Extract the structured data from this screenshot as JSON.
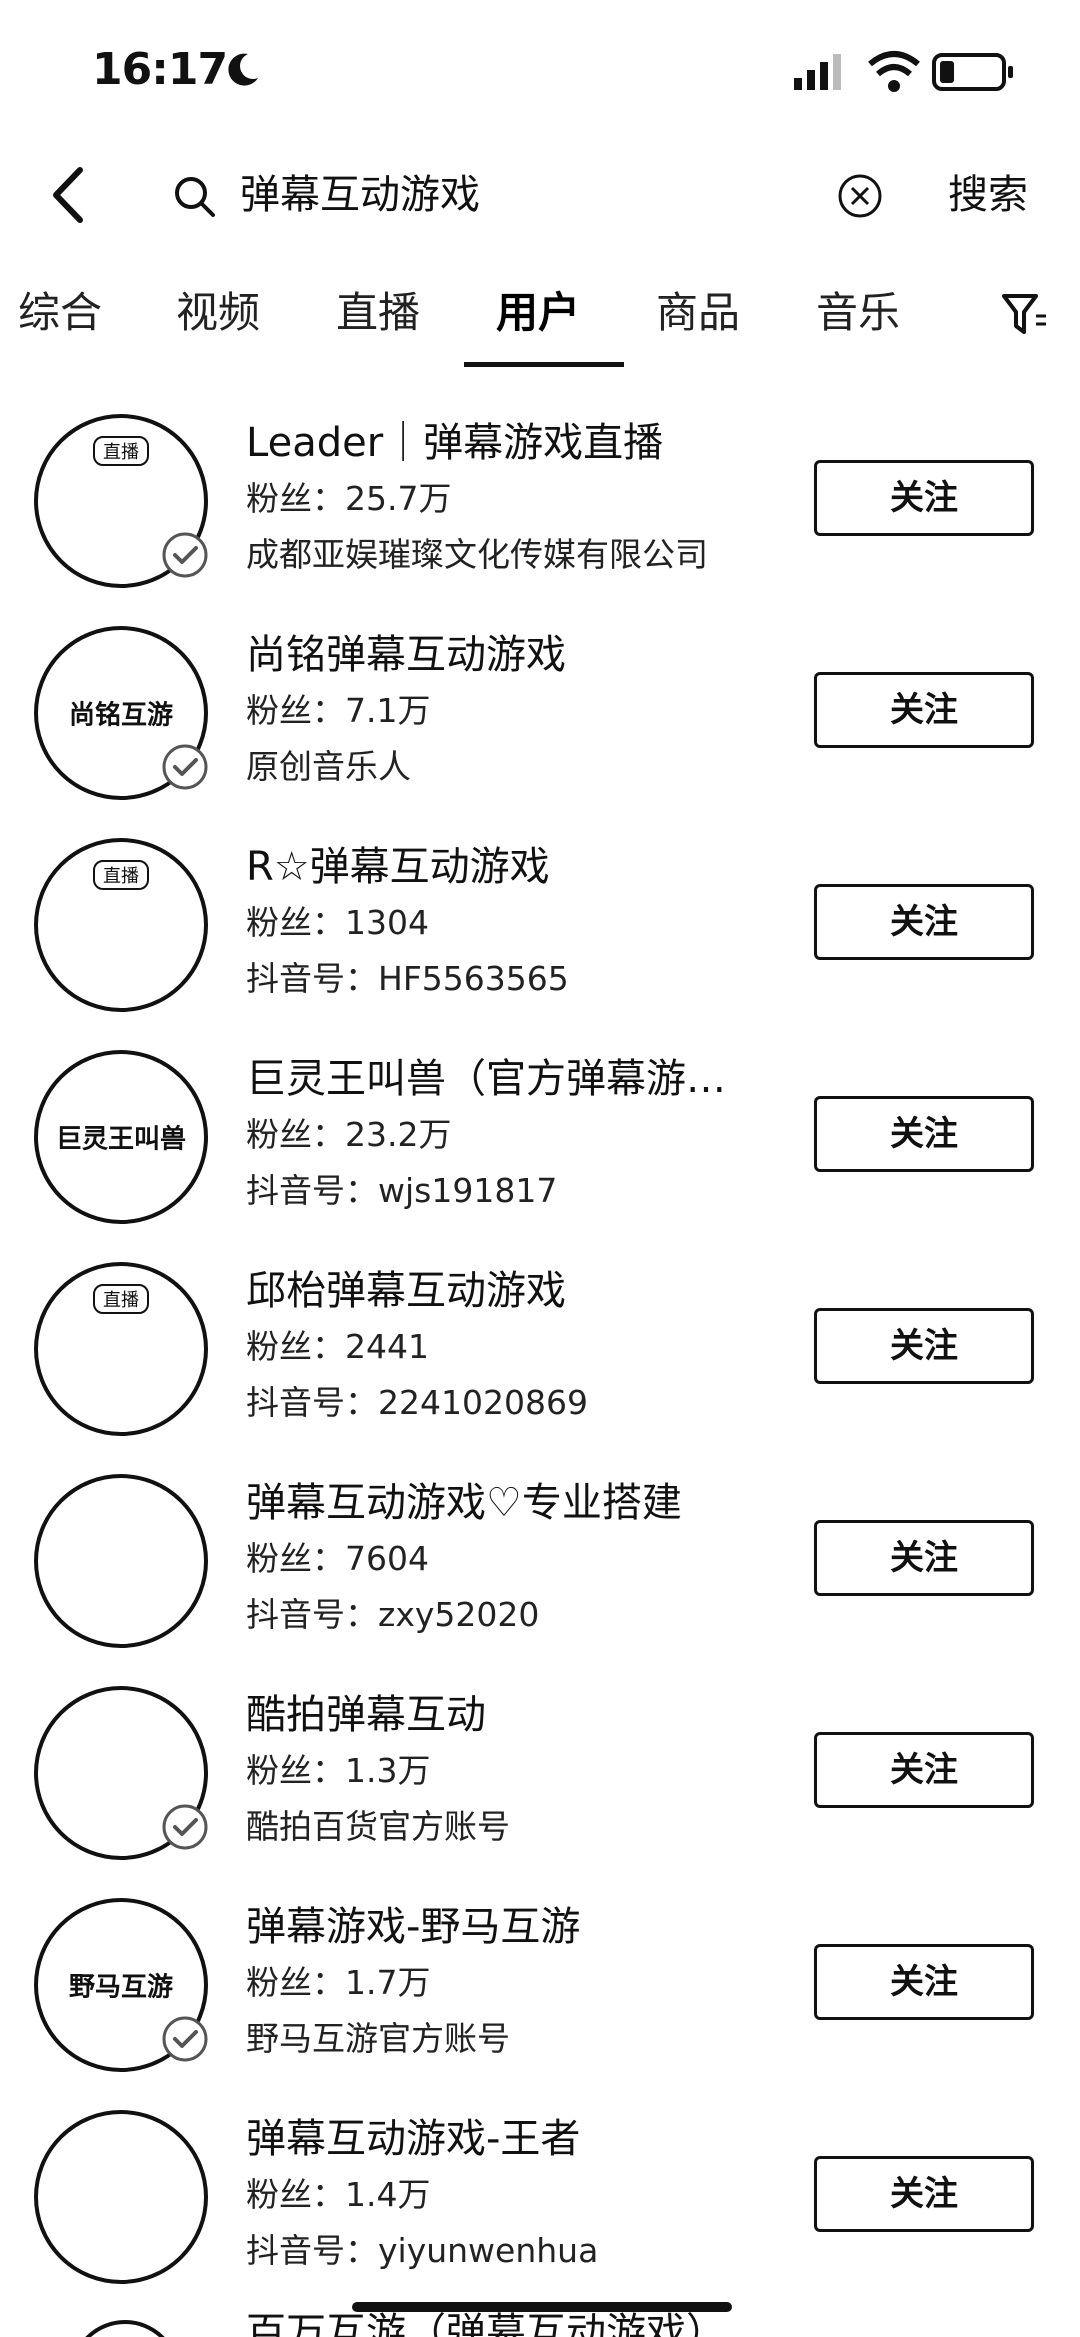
{
  "status_bar": {
    "time": "16:17"
  },
  "search": {
    "query": "弹幕互动游戏",
    "search_label": "搜索"
  },
  "tabs": [
    {
      "label": "综合"
    },
    {
      "label": "视频"
    },
    {
      "label": "直播"
    },
    {
      "label": "用户"
    },
    {
      "label": "商品"
    },
    {
      "label": "音乐"
    }
  ],
  "active_tab": "用户",
  "users": [
    {
      "name": "Leader｜弹幕游戏直播",
      "fans": "粉丝：25.7万",
      "sub": "成都亚娱璀璨文化传媒有限公司",
      "follow": "关注",
      "avatar_badge": "直播",
      "avatar_text": "",
      "verified": true
    },
    {
      "name": "尚铭弹幕互动游戏",
      "fans": "粉丝：7.1万",
      "sub": "原创音乐人",
      "follow": "关注",
      "avatar_badge": "",
      "avatar_text": "尚铭互游",
      "verified": true
    },
    {
      "name": "R☆弹幕互动游戏",
      "fans": "粉丝：1304",
      "sub": "抖音号：HF5563565",
      "follow": "关注",
      "avatar_badge": "直播",
      "avatar_text": "",
      "verified": false
    },
    {
      "name": "巨灵王叫兽（官方弹幕游…",
      "fans": "粉丝：23.2万",
      "sub": "抖音号：wjs191817",
      "follow": "关注",
      "avatar_badge": "",
      "avatar_text": "巨灵王叫兽",
      "verified": false
    },
    {
      "name": "邱枱弹幕互动游戏",
      "fans": "粉丝：2441",
      "sub": "抖音号：2241020869",
      "follow": "关注",
      "avatar_badge": "直播",
      "avatar_text": "",
      "verified": false
    },
    {
      "name": "弹幕互动游戏♡专业搭建",
      "fans": "粉丝：7604",
      "sub": "抖音号：zxy52020",
      "follow": "关注",
      "avatar_badge": "",
      "avatar_text": "",
      "verified": false
    },
    {
      "name": "酷拍弹幕互动",
      "fans": "粉丝：1.3万",
      "sub": "酷拍百货官方账号",
      "follow": "关注",
      "avatar_badge": "",
      "avatar_text": "",
      "verified": true
    },
    {
      "name": "弹幕游戏-野马互游",
      "fans": "粉丝：1.7万",
      "sub": "野马互游官方账号",
      "follow": "关注",
      "avatar_badge": "",
      "avatar_text": "野马互游",
      "verified": true
    },
    {
      "name": "弹幕互动游戏-王者",
      "fans": "粉丝：1.4万",
      "sub": "抖音号：yiyunwenhua",
      "follow": "关注",
      "avatar_badge": "",
      "avatar_text": "",
      "verified": false
    }
  ],
  "partial_user": {
    "name": "百万互游（弹幕互动游戏）"
  }
}
